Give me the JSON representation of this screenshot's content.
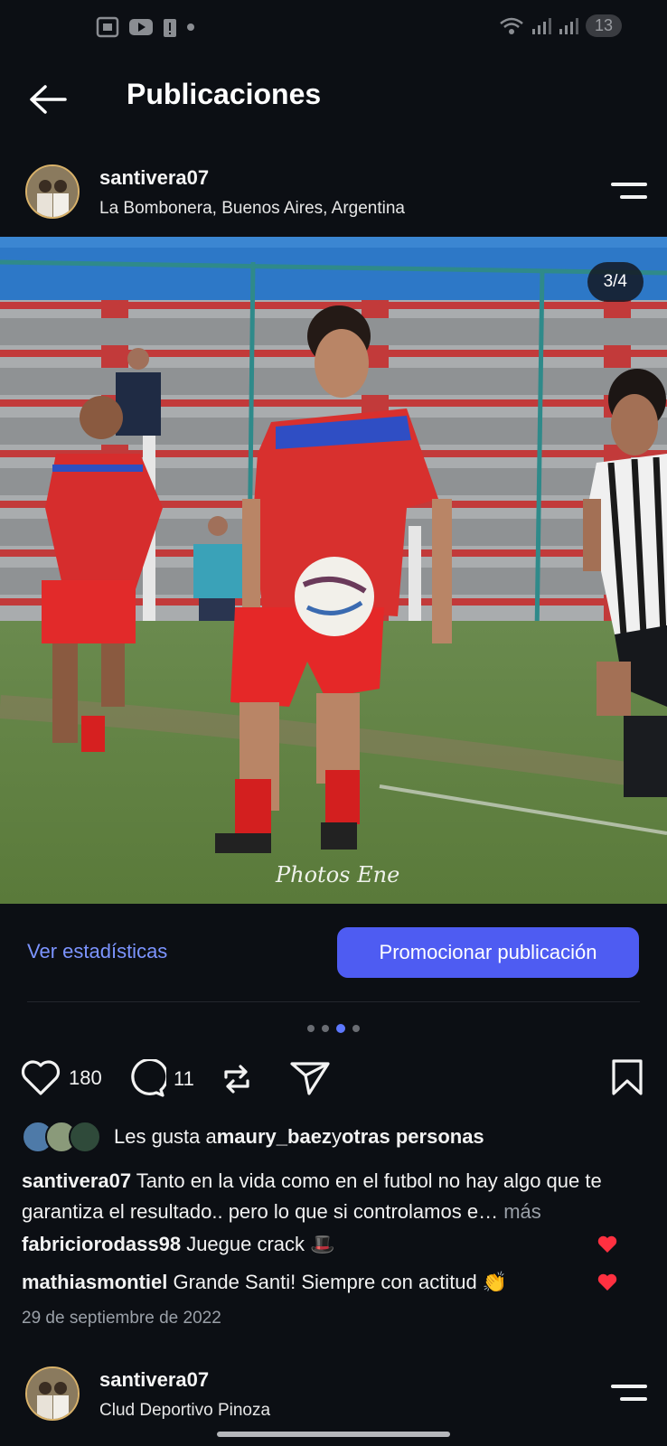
{
  "status_bar": {
    "battery": "13"
  },
  "header": {
    "title": "Publicaciones"
  },
  "post": {
    "username": "santivera07",
    "location": "La Bombonera, Buenos Aires, Argentina",
    "image_counter": "3/4",
    "watermark": "Photos Ene",
    "stats_link": "Ver estadísticas",
    "promote_button": "Promocionar publicación",
    "pagination": {
      "total": 4,
      "active": 3
    },
    "likes_count": "180",
    "comments_count": "11",
    "likes_prefix": "Les gusta a ",
    "likes_user": "maury_baez",
    "likes_mid": " y ",
    "likes_others": "otras personas",
    "caption_user": "santivera07",
    "caption_text": " Tanto en la vida como en el futbol no hay algo que te garantiza el resultado.. pero lo que si controlamos e…",
    "caption_more": " más",
    "comments": [
      {
        "user": "fabriciorodass98",
        "text": " Juegue crack 🎩"
      },
      {
        "user": "mathiasmontiel",
        "text": " Grande Santi! Siempre con actitud 👏"
      }
    ],
    "date": "29 de septiembre de 2022"
  },
  "next_post": {
    "username": "santivera07",
    "location": "Clud Deportivo Pinoza"
  },
  "colors": {
    "background": "#0c0f14",
    "accent": "#4e5cf2",
    "link": "#7c94ff",
    "heart": "#ff3040"
  }
}
